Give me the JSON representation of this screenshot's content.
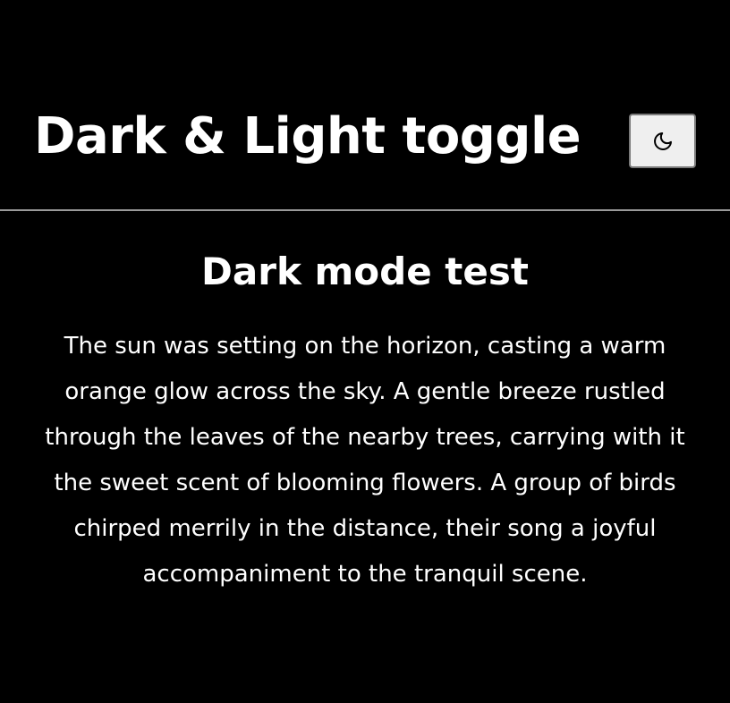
{
  "header": {
    "title": "Dark & Light toggle",
    "toggle_icon": "moon-icon"
  },
  "main": {
    "heading": "Dark mode test",
    "paragraph": "The sun was setting on the horizon, casting a warm orange glow across the sky. A gentle breeze rustled through the leaves of the nearby trees, carrying with it the sweet scent of blooming flowers. A group of birds chirped merrily in the distance, their song a joyful accompaniment to the tranquil scene."
  },
  "colors": {
    "background": "#000000",
    "text": "#ffffff",
    "divider": "#9a9a9a",
    "button_background": "#efefef"
  }
}
